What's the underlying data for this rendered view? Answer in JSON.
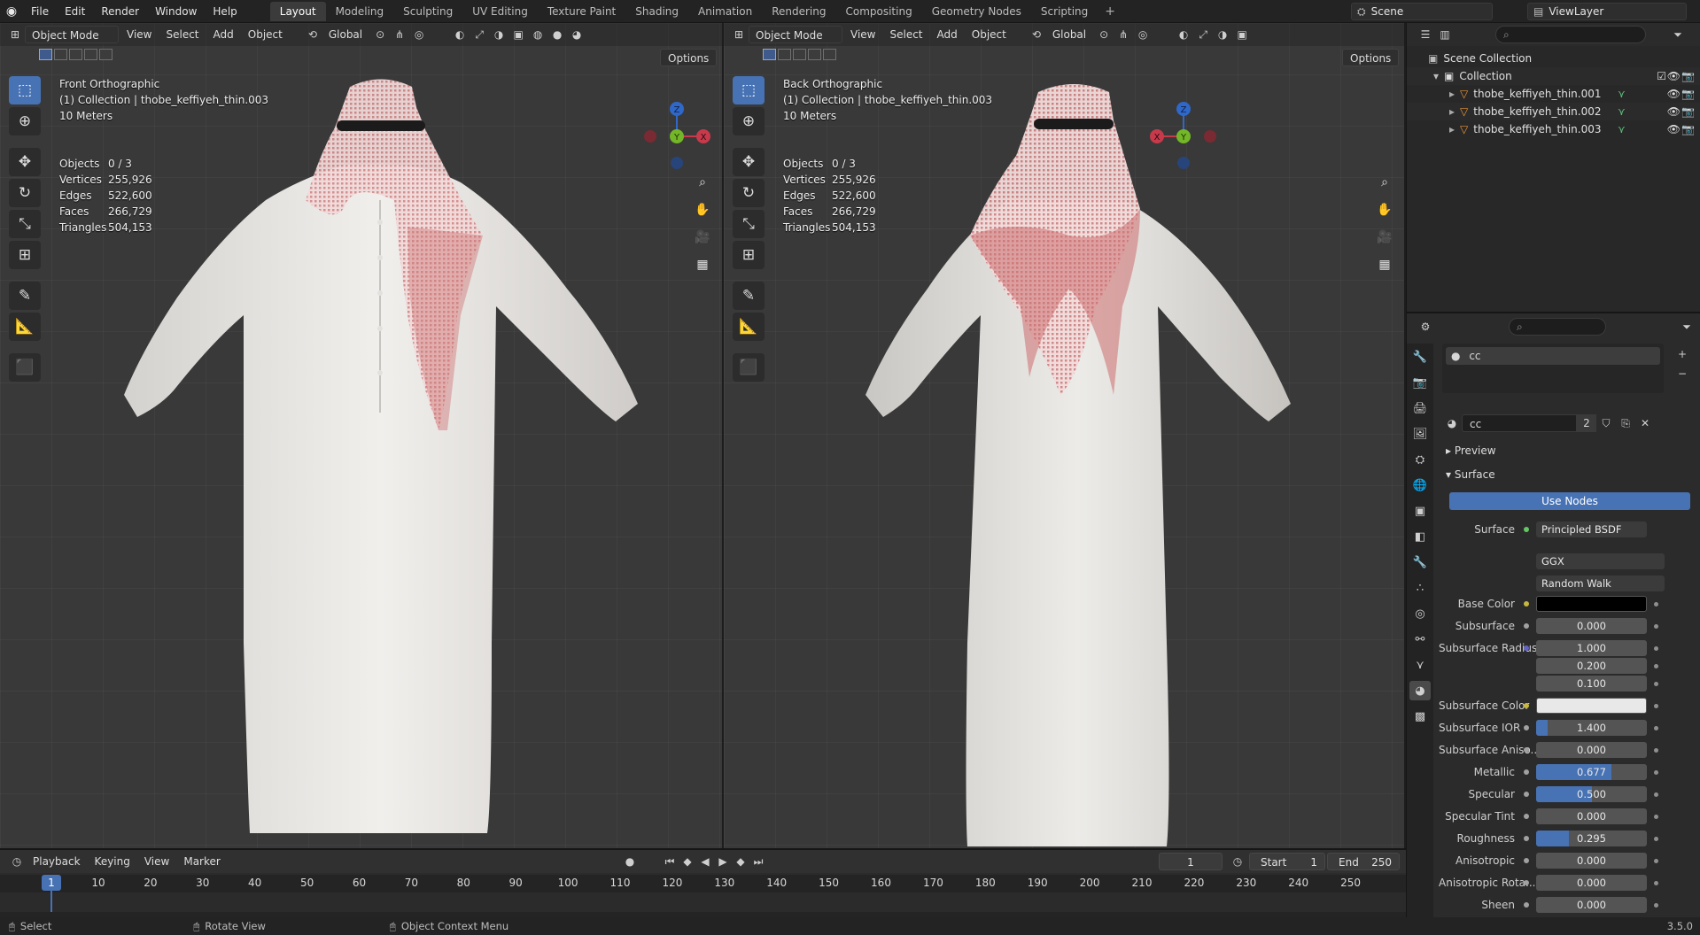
{
  "menu": [
    "File",
    "Edit",
    "Render",
    "Window",
    "Help"
  ],
  "workspaces": [
    "Layout",
    "Modeling",
    "Sculpting",
    "UV Editing",
    "Texture Paint",
    "Shading",
    "Animation",
    "Rendering",
    "Compositing",
    "Geometry Nodes",
    "Scripting"
  ],
  "scene": {
    "label": "Scene",
    "view_layer": "ViewLayer"
  },
  "viewport_left": {
    "mode": "Object Mode",
    "menus": [
      "View",
      "Select",
      "Add",
      "Object"
    ],
    "transform": "Global",
    "options": "Options",
    "view_name": "Front Orthographic",
    "collection": "(1) Collection | thobe_keffiyeh_thin.003",
    "scale": "10 Meters"
  },
  "viewport_right": {
    "mode": "Object Mode",
    "menus": [
      "View",
      "Select",
      "Add",
      "Object"
    ],
    "transform": "Global",
    "options": "Options",
    "view_name": "Back Orthographic",
    "collection": "(1) Collection | thobe_keffiyeh_thin.003",
    "scale": "10 Meters"
  },
  "stats": [
    {
      "k": "Objects",
      "v": "0 / 3"
    },
    {
      "k": "Vertices",
      "v": "255,926"
    },
    {
      "k": "Edges",
      "v": "522,600"
    },
    {
      "k": "Faces",
      "v": "266,729"
    },
    {
      "k": "Triangles",
      "v": "504,153"
    }
  ],
  "gizmo": {
    "x": "X",
    "y": "Y",
    "z": "Z"
  },
  "outliner": {
    "root": "Scene Collection",
    "collection": "Collection",
    "objects": [
      "thobe_keffiyeh_thin.001",
      "thobe_keffiyeh_thin.002",
      "thobe_keffiyeh_thin.003"
    ]
  },
  "properties": {
    "material_slot": "cc",
    "material_name": "cc",
    "users": "2",
    "preview": "Preview",
    "surface_panel": "Surface",
    "use_nodes": "Use Nodes",
    "surface_label": "Surface",
    "surface_value": "Principled BSDF",
    "distribution": "GGX",
    "subsurface_method": "Random Walk",
    "rows": [
      {
        "label": "Base Color",
        "type": "color",
        "color": "#000000"
      },
      {
        "label": "Subsurface",
        "value": "0.000",
        "fill": 0
      },
      {
        "label": "Subsurface Radius",
        "value": "1.000",
        "fill": 0
      },
      {
        "label": "",
        "value": "0.200",
        "fill": 0
      },
      {
        "label": "",
        "value": "0.100",
        "fill": 0
      },
      {
        "label": "Subsurface Color",
        "type": "color",
        "color": "#e8e8e8"
      },
      {
        "label": "Subsurface IOR",
        "value": "1.400",
        "fill": 0.1
      },
      {
        "label": "Subsurface Aniso...",
        "value": "0.000",
        "fill": 0
      },
      {
        "label": "Metallic",
        "value": "0.677",
        "fill": 0.677
      },
      {
        "label": "Specular",
        "value": "0.500",
        "fill": 0.5
      },
      {
        "label": "Specular Tint",
        "value": "0.000",
        "fill": 0
      },
      {
        "label": "Roughness",
        "value": "0.295",
        "fill": 0.295
      },
      {
        "label": "Anisotropic",
        "value": "0.000",
        "fill": 0
      },
      {
        "label": "Anisotropic Rota...",
        "value": "0.000",
        "fill": 0
      },
      {
        "label": "Sheen",
        "value": "0.000",
        "fill": 0
      }
    ]
  },
  "timeline": {
    "menus": [
      "Playback",
      "Keying",
      "View",
      "Marker"
    ],
    "current_frame": "1",
    "start_label": "Start",
    "start": "1",
    "end_label": "End",
    "end": "250",
    "ticks": [
      "10",
      "20",
      "30",
      "40",
      "50",
      "60",
      "70",
      "80",
      "90",
      "100",
      "110",
      "120",
      "130",
      "140",
      "150",
      "160",
      "170",
      "180",
      "190",
      "200",
      "210",
      "220",
      "230",
      "240",
      "250"
    ]
  },
  "statusbar": {
    "select": "Select",
    "rotate": "Rotate View",
    "context": "Object Context Menu",
    "version": "3.5.0"
  }
}
